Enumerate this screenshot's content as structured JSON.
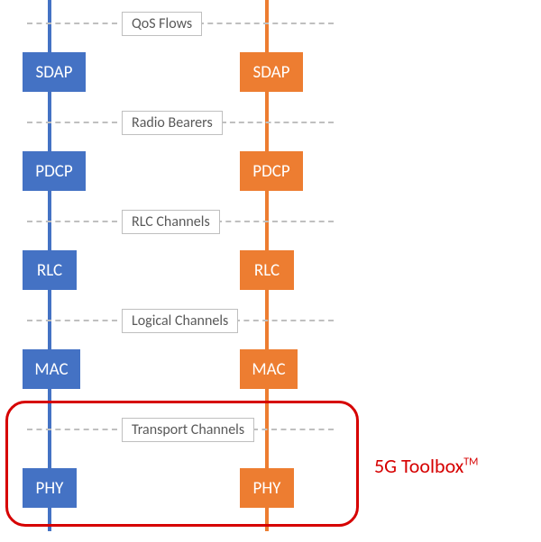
{
  "diagram": {
    "type": "protocol-stack",
    "stacks": [
      {
        "id": "left",
        "color": "#4472c4",
        "layers": [
          "SDAP",
          "PDCP",
          "RLC",
          "MAC",
          "PHY"
        ]
      },
      {
        "id": "right",
        "color": "#ed7d31",
        "layers": [
          "SDAP",
          "PDCP",
          "RLC",
          "MAC",
          "PHY"
        ]
      }
    ],
    "interfaces_top_to_bottom": [
      "QoS Flows",
      "Radio Bearers",
      "RLC Channels",
      "Logical Channels",
      "Transport Channels"
    ],
    "callout": {
      "label_html": "5G Toolbox<sup>TM</sup>",
      "encloses_layers": [
        "PHY"
      ],
      "includes_interface": "Transport Channels"
    }
  },
  "labels": {
    "left": {
      "sdap": "SDAP",
      "pdcp": "PDCP",
      "rlc": "RLC",
      "mac": "MAC",
      "phy": "PHY"
    },
    "right": {
      "sdap": "SDAP",
      "pdcp": "PDCP",
      "rlc": "RLC",
      "mac": "MAC",
      "phy": "PHY"
    },
    "if0": "QoS Flows",
    "if1": "Radio Bearers",
    "if2": "RLC Channels",
    "if3": "Logical Channels",
    "if4": "Transport Channels",
    "toolbox": "5G Toolbox"
  },
  "colors": {
    "left": "#4472c4",
    "right": "#ed7d31",
    "dash": "#bfbfbf",
    "callout": "#d60000"
  }
}
